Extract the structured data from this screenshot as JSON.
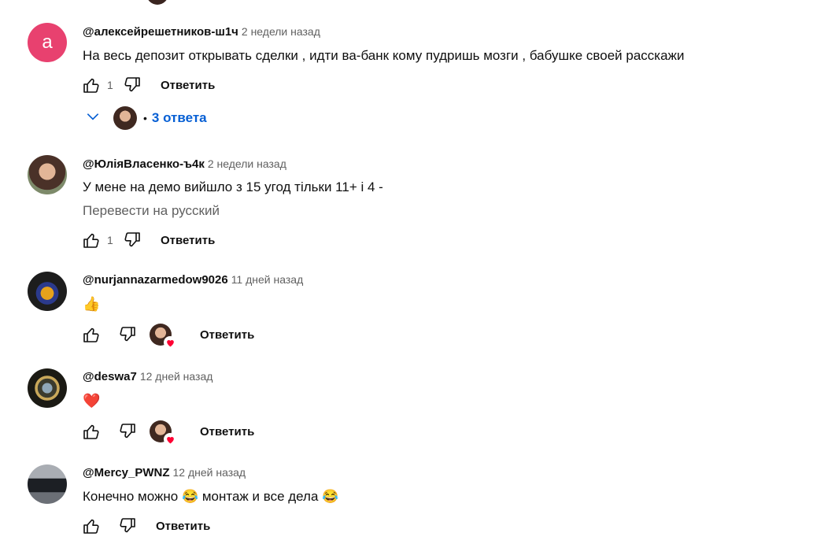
{
  "comments": [
    {
      "avatar_letter": "а",
      "author": "@алексейрешетников-ш1ч",
      "time": "2 недели назад",
      "text": "На весь депозит открывать сделки  , идти ва-банк  кому пудришь мозги , бабушке своей расскажи",
      "likes": "1",
      "reply_label": "Ответить",
      "replies_label": "3 ответа"
    },
    {
      "author": "@ЮліяВласенко-ъ4к",
      "time": "2 недели назад",
      "text": "У мене на демо вийшло з 15 угод тільки 11+ і 4 -",
      "translate_label": "Перевести на русский",
      "likes": "1",
      "reply_label": "Ответить"
    },
    {
      "author": "@nurjannazarmedow9026",
      "time": "11 дней назад",
      "text": "👍",
      "reply_label": "Ответить"
    },
    {
      "author": "@deswa7",
      "time": "12 дней назад",
      "text": "❤️",
      "reply_label": "Ответить"
    },
    {
      "author": "@Mercy_PWNZ",
      "time": "12 дней назад",
      "text": "Конечно можно 😂  монтаж и все дела 😂",
      "reply_label": "Ответить"
    }
  ],
  "icons": {
    "like": "thumb-up-icon",
    "dislike": "thumb-down-icon",
    "expand": "chevron-down-icon",
    "heart": "heart-icon"
  },
  "colors": {
    "link": "#065fd4",
    "secondary_text": "#606060",
    "avatar_letter_bg": "#e8416f",
    "heart": "#ff0033"
  }
}
